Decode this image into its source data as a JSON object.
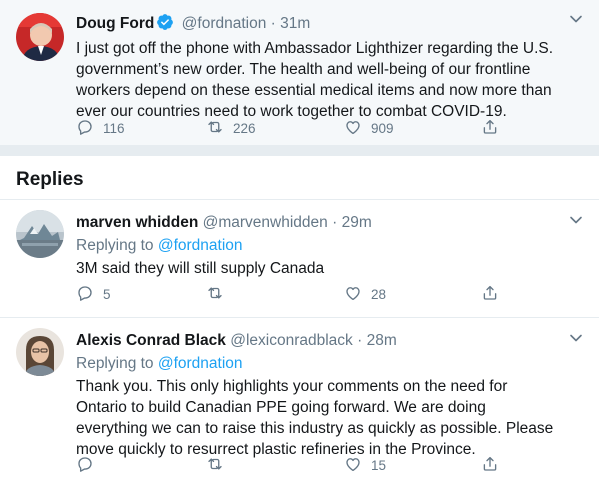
{
  "main_tweet": {
    "name": "Doug Ford",
    "handle": "@fordnation",
    "separator": "·",
    "time": "31m",
    "text": "I just got off the phone with Ambassador Lighthizer regarding the U.S. government’s new order. The health and well-being of our frontline workers depend on these essential medical items and now more than ever our countries need to work together to combat COVID-19.",
    "replies": "116",
    "retweets": "226",
    "likes": "909"
  },
  "replies_section": {
    "title": "Replies"
  },
  "reply_1": {
    "name": "marven whidden",
    "handle": "@marvenwhidden",
    "separator": "·",
    "time": "29m",
    "replying_prefix": "Replying to",
    "replying_handle": "@fordnation",
    "text": "3M said they will still supply Canada",
    "replies": "5",
    "retweets": "",
    "likes": "28"
  },
  "reply_2": {
    "name": "Alexis Conrad Black",
    "handle": "@lexiconradblack",
    "separator": "·",
    "time": "28m",
    "replying_prefix": "Replying to",
    "replying_handle": "@fordnation",
    "text": "Thank you. This only highlights your comments on the need for Ontario to build Canadian PPE going forward. We are doing everything we can to raise this industry as quickly as possible. Please move quickly to resurrect plastic refineries in the Province.",
    "replies": "",
    "retweets": "",
    "likes": "15"
  },
  "colors": {
    "accent": "#1da1f2",
    "muted": "#657786",
    "main_bg": "#f5f8fa",
    "divider": "#e6ecf0"
  },
  "icons": [
    "verified-badge-icon",
    "reply-icon",
    "retweet-icon",
    "like-icon",
    "share-icon",
    "chevron-down-icon"
  ]
}
